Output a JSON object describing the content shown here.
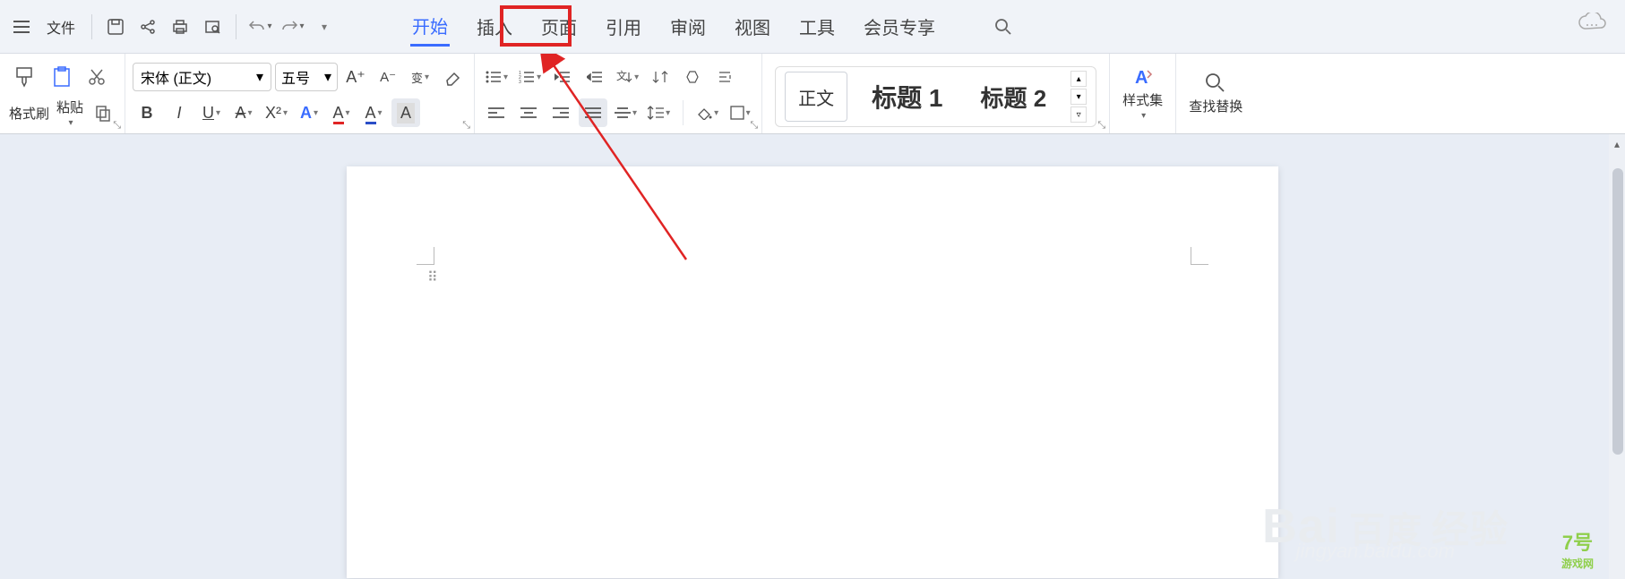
{
  "topbar": {
    "file_label": "文件",
    "menu": [
      "开始",
      "插入",
      "页面",
      "引用",
      "审阅",
      "视图",
      "工具",
      "会员专享"
    ],
    "active_index": 0,
    "highlighted_index": 2
  },
  "ribbon": {
    "format_painter": "格式刷",
    "paste": "粘贴",
    "font_name": "宋体 (正文)",
    "font_size": "五号",
    "style_set": "样式集",
    "find_replace": "查找替换",
    "styles": {
      "normal": "正文",
      "heading1": "标题 1",
      "heading2": "标题 2"
    }
  },
  "watermark": {
    "brand_main": "Bai",
    "brand_du": "百度",
    "brand_suffix": "经验",
    "sub": "jingyan.baidu.com"
  },
  "right_logo": {
    "num": "7号",
    "text": "游戏网"
  }
}
